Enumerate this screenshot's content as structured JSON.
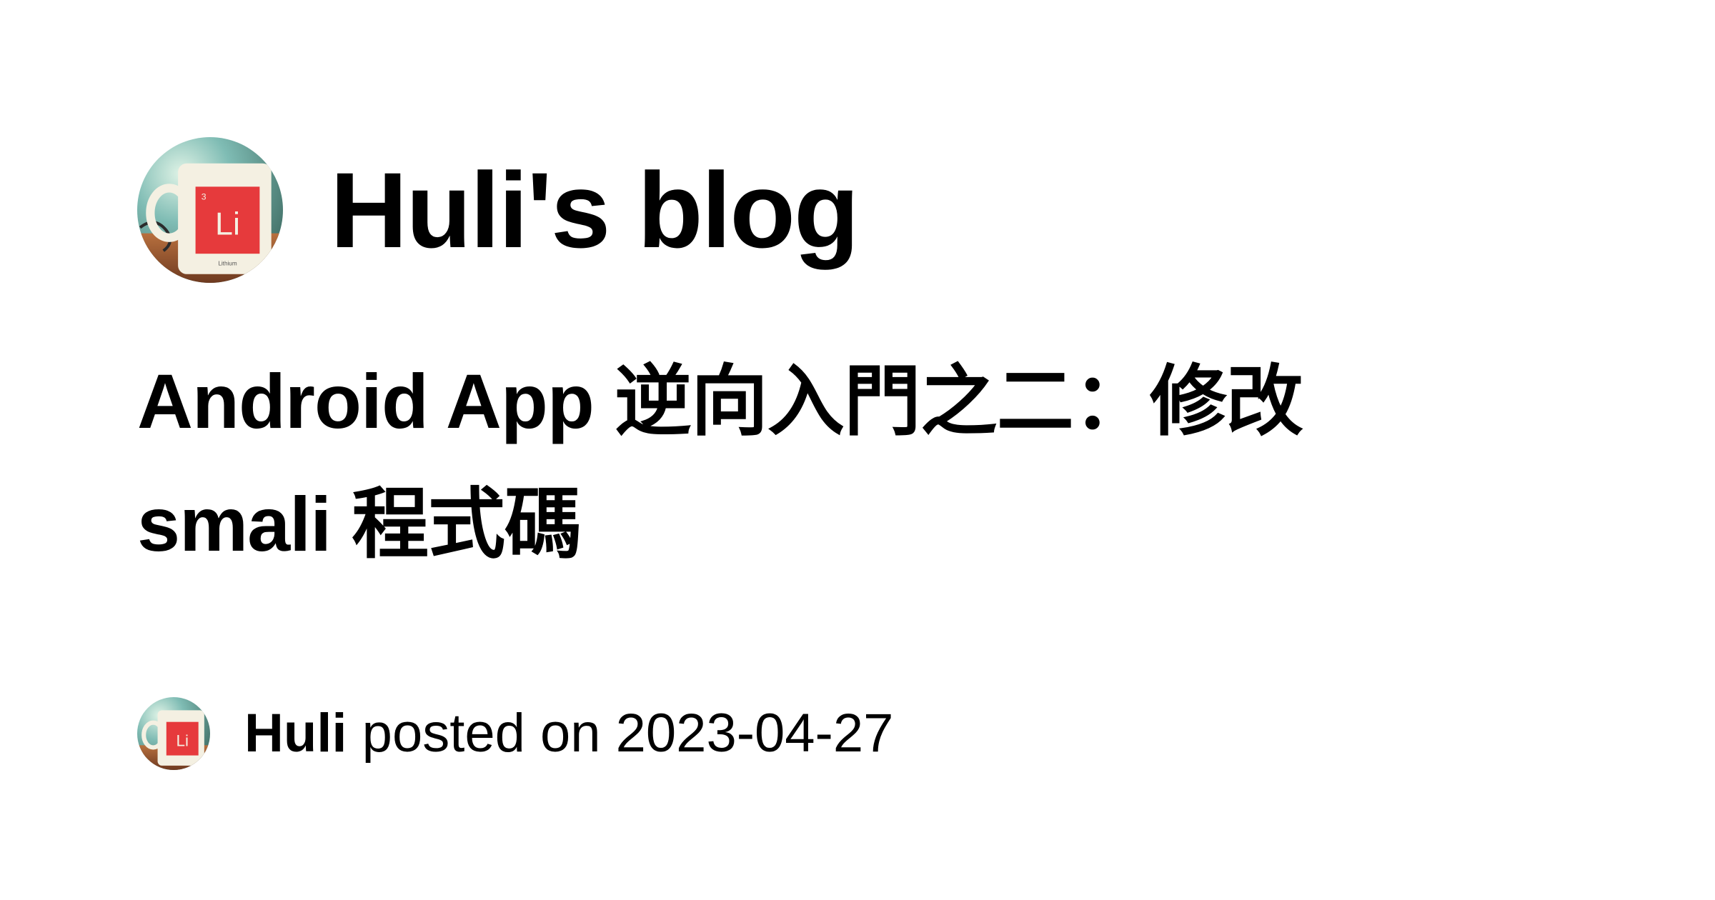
{
  "blog": {
    "title": "Huli's blog",
    "avatar_icon": "mug-avatar-icon",
    "avatar_mug_text": "Li",
    "avatar_mug_number": "3",
    "avatar_mug_caption": "Lithium"
  },
  "post": {
    "title": "Android App 逆向入門之二：修改 smali 程式碼",
    "author": "Huli",
    "posted_label": "posted on",
    "date": "2023-04-27"
  },
  "colors": {
    "background": "#ffffff",
    "text": "#000000",
    "mug_red": "#e63a3c",
    "mug_white": "#f4f0e2",
    "avatar_teal": "#7fbcb4",
    "avatar_wood": "#9a5a36"
  }
}
